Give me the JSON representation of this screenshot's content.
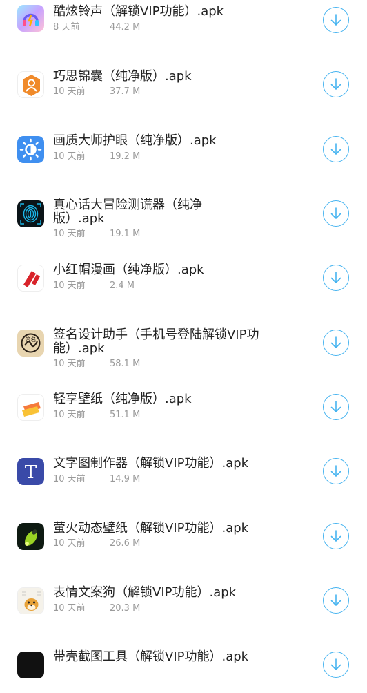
{
  "downloads": [
    {
      "name": "酷炫铃声（解锁VIP功能）.apk",
      "age": "8 天前",
      "size": "44.2 M",
      "icon": "ringtone-icon",
      "accent": "#7b6cf2"
    },
    {
      "name": "巧思锦囊（纯净版）.apk",
      "age": "10 天前",
      "size": "37.7 M",
      "icon": "qiaosi-icon",
      "accent": "#f08a2a"
    },
    {
      "name": "画质大师护眼（纯净版）.apk",
      "age": "10 天前",
      "size": "19.2 M",
      "icon": "eye-care-icon",
      "accent": "#3f8ff0"
    },
    {
      "name": "真心话大冒险测谎器（纯净版）.apk",
      "age": "10 天前",
      "size": "19.1 M",
      "icon": "fingerprint-icon",
      "accent": "#1ab6e8"
    },
    {
      "name": "小红帽漫画（纯净版）.apk",
      "age": "10 天前",
      "size": "2.4 M",
      "icon": "red-hat-icon",
      "accent": "#d8232a"
    },
    {
      "name": "签名设计助手（手机号登陆解锁VIP功能）.apk",
      "age": "10 天前",
      "size": "58.1 M",
      "icon": "signature-icon",
      "accent": "#c8a36a"
    },
    {
      "name": "轻享壁纸（纯净版）.apk",
      "age": "10 天前",
      "size": "51.1 M",
      "icon": "wallpaper-icon",
      "accent": "#f57a3c"
    },
    {
      "name": "文字图制作器（解锁VIP功能）.apk",
      "age": "10 天前",
      "size": "14.9 M",
      "icon": "text-t-icon",
      "accent": "#3a4aa8"
    },
    {
      "name": "萤火动态壁纸（解锁VIP功能）.apk",
      "age": "10 天前",
      "size": "26.6 M",
      "icon": "firefly-icon",
      "accent": "#9bd424"
    },
    {
      "name": "表情文案狗（解锁VIP功能）.apk",
      "age": "10 天前",
      "size": "20.3 M",
      "icon": "meme-dog-icon",
      "accent": "#e8a33a"
    },
    {
      "name": "带壳截图工具（解锁VIP功能）.apk",
      "age": "",
      "size": "",
      "icon": "screenshot-icon",
      "accent": "#111111"
    }
  ],
  "colors": {
    "button": "#47b4f0",
    "title": "#222222",
    "meta": "#9a9a9a"
  }
}
